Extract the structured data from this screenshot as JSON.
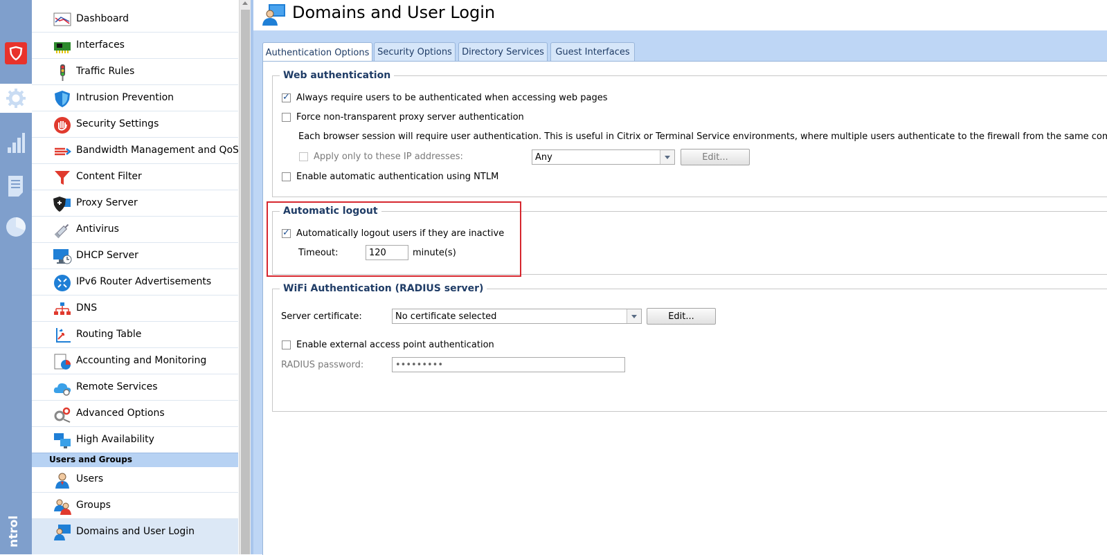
{
  "rail": {
    "vertical_label": "ntrol",
    "accent_color": "#e8322b"
  },
  "nav": {
    "items": [
      {
        "label": "Dashboard",
        "icon": "dashboard-icon"
      },
      {
        "label": "Interfaces",
        "icon": "network-card-icon"
      },
      {
        "label": "Traffic Rules",
        "icon": "traffic-light-icon"
      },
      {
        "label": "Intrusion Prevention",
        "icon": "shield-icon"
      },
      {
        "label": "Security Settings",
        "icon": "hand-stop-icon"
      },
      {
        "label": "Bandwidth Management and QoS",
        "icon": "bandwidth-icon"
      },
      {
        "label": "Content Filter",
        "icon": "funnel-icon"
      },
      {
        "label": "Proxy Server",
        "icon": "proxy-icon"
      },
      {
        "label": "Antivirus",
        "icon": "syringe-icon"
      },
      {
        "label": "DHCP Server",
        "icon": "dhcp-icon"
      },
      {
        "label": "IPv6 Router Advertisements",
        "icon": "ipv6-icon"
      },
      {
        "label": "DNS",
        "icon": "dns-icon"
      },
      {
        "label": "Routing Table",
        "icon": "routing-icon"
      },
      {
        "label": "Accounting and Monitoring",
        "icon": "accounting-icon"
      },
      {
        "label": "Remote Services",
        "icon": "cloud-icon"
      },
      {
        "label": "Advanced Options",
        "icon": "gears-icon"
      },
      {
        "label": "High Availability",
        "icon": "monitors-icon"
      }
    ],
    "section": "Users and Groups",
    "user_items": [
      {
        "label": "Users",
        "icon": "user-icon"
      },
      {
        "label": "Groups",
        "icon": "group-icon"
      },
      {
        "label": "Domains and User Login",
        "icon": "domain-user-icon"
      }
    ]
  },
  "header": {
    "title": "Domains and User Login"
  },
  "tabs": [
    "Authentication Options",
    "Security Options",
    "Directory Services",
    "Guest Interfaces"
  ],
  "web_auth": {
    "legend": "Web authentication",
    "always_require": {
      "label": "Always require users to be authenticated when accessing web pages",
      "checked": true
    },
    "force_proxy": {
      "label": "Force non-transparent proxy server authentication",
      "checked": false
    },
    "description": "Each browser session will require user authentication. This is useful in Citrix or Terminal Service environments, where multiple users authenticate to the firewall from the same computer.",
    "apply_only": {
      "label": "Apply only to these IP addresses:",
      "checked": false
    },
    "ip_select_value": "Any",
    "edit_label": "Edit...",
    "ntlm": {
      "label": "Enable automatic authentication using NTLM",
      "checked": false
    }
  },
  "auto_logout": {
    "legend": "Automatic logout",
    "inactive": {
      "label": "Automatically logout users if they are inactive",
      "checked": true
    },
    "timeout_label": "Timeout:",
    "timeout_value": "120",
    "unit": "minute(s)"
  },
  "wifi": {
    "legend": "WiFi Authentication (RADIUS server)",
    "cert_label": "Server certificate:",
    "cert_value": "No certificate selected",
    "edit_label": "Edit...",
    "external_ap": {
      "label": "Enable external access point authentication",
      "checked": false
    },
    "radius_label": "RADIUS password:",
    "radius_value": "•••••••••"
  }
}
